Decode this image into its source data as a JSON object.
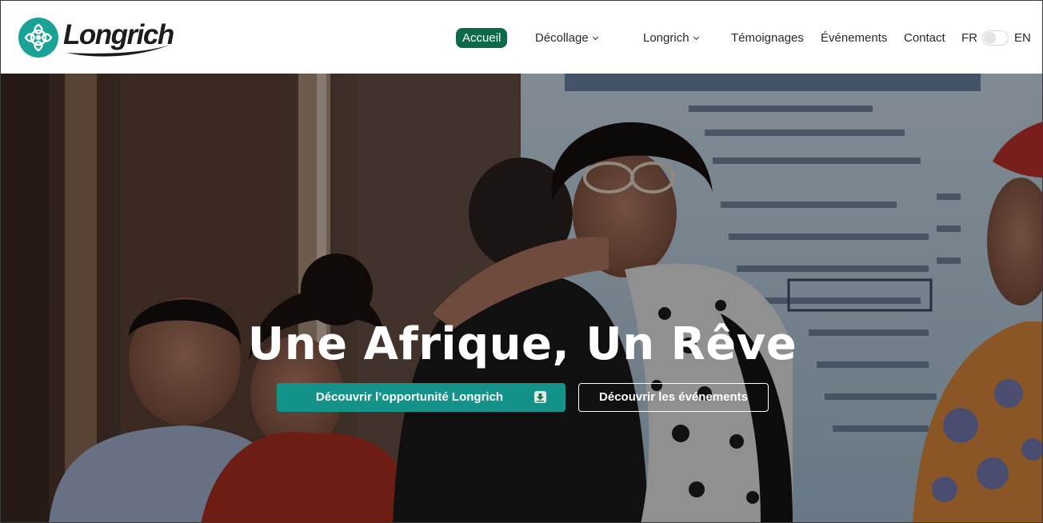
{
  "brand": {
    "name": "Longrich",
    "icon": "longrich-logo-icon",
    "primary_color": "#1aa298",
    "nav_active_color": "#0b6a47"
  },
  "nav": {
    "items": [
      {
        "label": "Accueil",
        "active": true
      },
      {
        "label": "Décollage",
        "dropdown": true,
        "icon": "chevron-down-icon"
      },
      {
        "label": "Longrich",
        "dropdown": true,
        "icon": "chevron-down-icon"
      },
      {
        "label": "Témoignages"
      },
      {
        "label": "Événements"
      },
      {
        "label": "Contact"
      }
    ],
    "language": {
      "left": "FR",
      "right": "EN",
      "selected": "FR"
    }
  },
  "hero": {
    "title": "Une Afrique, Un Rêve",
    "primary_button": {
      "label": "Découvrir l’opportunité Longrich",
      "icon": "download-icon"
    },
    "secondary_button": {
      "label": "Découvrir les événements"
    }
  }
}
